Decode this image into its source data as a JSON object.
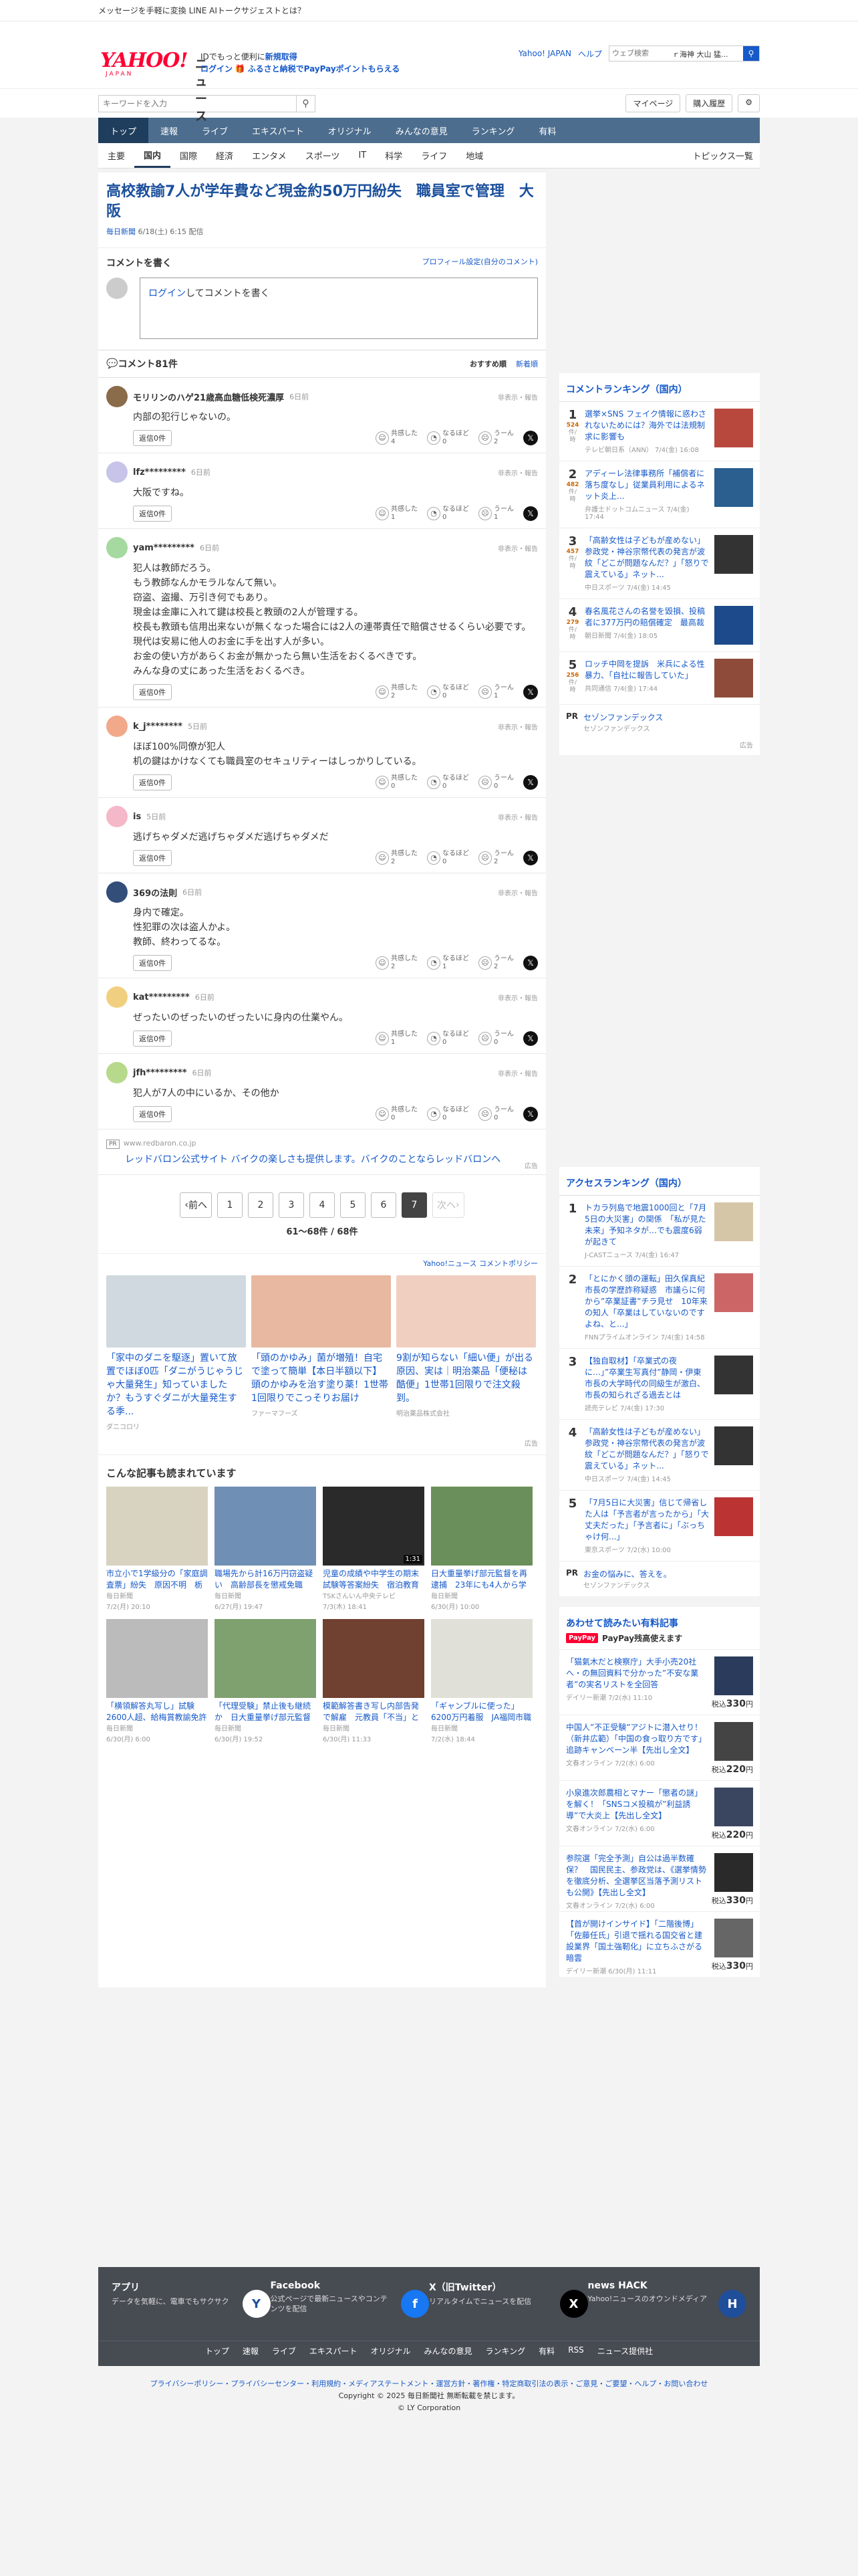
{
  "topstrip": {
    "text": "メッセージを手軽に変換 LINE AIトークサジェストとは？"
  },
  "header": {
    "logo_main": "YAHOO!",
    "logo_sub": "JAPAN",
    "logo_news": "ニュース",
    "promo_line1a": "IDでもっと便利に",
    "promo_line1b": "新規取得",
    "promo_line2a": "ログイン",
    "promo_line2b": "ふるさと納税でPayPayポイントもらえる",
    "links": [
      "Yahoo! JAPAN",
      "ヘルプ"
    ],
    "search_placeholder": "ウェブ検索",
    "search_value": "ｒ海神 大山 猛..."
  },
  "bar2": {
    "keyword_placeholder": "キーワードを入力",
    "mypage": "マイページ",
    "purchase": "購入履歴"
  },
  "gnav": [
    "トップ",
    "速報",
    "ライブ",
    "エキスパート",
    "オリジナル",
    "みんなの意見",
    "ランキング",
    "有料"
  ],
  "snav": [
    "主要",
    "国内",
    "国際",
    "経済",
    "エンタメ",
    "スポーツ",
    "IT",
    "科学",
    "ライフ",
    "地域"
  ],
  "snav_more": "トピックス一覧",
  "article": {
    "title": "高校教諭7人が学年費など現金約50万円紛失　職員室で管理　大阪",
    "publisher": "毎日新聞",
    "date": "6/18(土) 6:15 配信"
  },
  "comment_form": {
    "header": "コメントを書く",
    "profile_link": "プロフィール設定(自分のコメント)",
    "login": "ログイン",
    "rest": "してコメントを書く"
  },
  "comments_header": {
    "count": "コメント81件",
    "sort1": "おすすめ順",
    "sort2": "新着順"
  },
  "reply_label": "返信0件",
  "hide_label": "非表示・報告",
  "reaction_labels": [
    "共感した",
    "なるほど",
    "うーん"
  ],
  "comments": [
    {
      "user": "モリリンのハゲ21歳高血糖低検死濃厚",
      "time": "6日前",
      "text": "内部の犯行じゃないの。",
      "r": [
        "4",
        "0",
        "2"
      ],
      "color": "#8a6b4a"
    },
    {
      "user": "lfz*********",
      "time": "6日前",
      "text": "大阪ですね。",
      "r": [
        "1",
        "0",
        "1"
      ],
      "color": "#c7c4ea"
    },
    {
      "user": "yam*********",
      "time": "6日前",
      "text": "犯人は教師だろう。\nもう教師なんかモラルなんて無い。\n窃盗、盗撮、万引き何でもあり。\n現金は金庫に入れて鍵は校長と教頭の2人が管理する。\n校長も教頭も信用出来ないが無くなった場合には2人の連帯責任で賠償させるくらい必要です。\n現代は安易に他人のお金に手を出す人が多い。\nお金の使い方があらくお金が無かったら無い生活をおくるべきです。\nみんな身の丈にあった生活をおくるべき。",
      "r": [
        "2",
        "0",
        "1"
      ],
      "color": "#a6d9a0"
    },
    {
      "user": "k_j********",
      "time": "5日前",
      "text": "ほぼ100%同僚が犯人\n机の鍵はかけなくても職員室のセキュリティーはしっかりしている。",
      "r": [
        "0",
        "0",
        "0"
      ],
      "color": "#f1a98a"
    },
    {
      "user": "is",
      "time": "5日前",
      "text": "逃げちゃダメだ逃げちゃダメだ逃げちゃダメだ",
      "r": [
        "2",
        "0",
        "2"
      ],
      "color": "#f4b8c8"
    },
    {
      "user": "369の法則",
      "time": "6日前",
      "text": "身内で確定。\n性犯罪の次は盗人かよ。\n教師、終わってるな。",
      "r": [
        "2",
        "1",
        "2"
      ],
      "color": "#344e7a"
    },
    {
      "user": "kat*********",
      "time": "6日前",
      "text": "ぜったいのぜったいのぜったいに身内の仕業やん。",
      "r": [
        "1",
        "0",
        "0"
      ],
      "color": "#f0d080"
    },
    {
      "user": "jfh*********",
      "time": "6日前",
      "text": "犯人が7人の中にいるか、その他か",
      "r": [
        "0",
        "0",
        "0"
      ],
      "color": "#b7d98b"
    }
  ],
  "pr": {
    "tag": "PR",
    "url": "www.redbaron.co.jp",
    "text": "レッドバロン公式サイト バイクの楽しさも提供します。バイクのことならレッドバロンへ",
    "ad": "広告"
  },
  "pager": {
    "prev": "前へ",
    "next": "次へ",
    "pages": [
      "1",
      "2",
      "3",
      "4",
      "5",
      "6",
      "7"
    ],
    "current": "7",
    "info": "61〜68件 / 68件"
  },
  "policy": "Yahoo!ニュース コメントポリシー",
  "ads": [
    {
      "title": "「家中のダニを駆逐」置いて放置でほぼ0匹「ダニがうじゃうじゃ大量発生」知っていましたか？もうすぐダニが大量発生する季...",
      "sponsor": "ダニコロリ",
      "color": "#cfd9df"
    },
    {
      "title": "「頭のかゆみ」菌が増殖！自宅で塗って簡単【本日半額以下】頭のかゆみを治す塗り薬！1世帯1回限りでこっそりお届け",
      "sponsor": "ファーマフーズ",
      "color": "#e8b8a0"
    },
    {
      "title": "9割が知らない「細い便」が出る原因、実は｜明治薬品「便秘は酷便」1世帯1回限りで注文殺到。",
      "sponsor": "明治薬品株式会社",
      "color": "#f1cfc0"
    }
  ],
  "ad_label": "広告",
  "read_title": "こんな記事も読まれています",
  "read_items": [
    {
      "title": "市立小で1学級分の「家庭調査票」紛失　原因不明　栃木・小...",
      "src": "毎日新聞",
      "date": "7/2(月) 20:10",
      "color": "#d8d2c0",
      "dur": ""
    },
    {
      "title": "職場先から計16万円窃盗疑い　高齢部長を懲戒免職　神奈川県警",
      "src": "毎日新聞",
      "date": "6/27(月) 19:47",
      "color": "#6f8fb5",
      "dur": ""
    },
    {
      "title": "児童の成績や中学生の期末試験等答案紛失　宿泊教育関係の個人情報...",
      "src": "TSKさんいん中央テレビ",
      "date": "7/3(木) 18:41",
      "color": "#2a2a2a",
      "dur": "1:31"
    },
    {
      "title": "日大重量挙げ部元監督を再逮捕　23年にも4人から学費詐取疑い",
      "src": "毎日新聞",
      "date": "6/30(月) 10:00",
      "color": "#6a8f5a",
      "dur": ""
    },
    {
      "title": "「横領解答丸写し」試験　2600人超、給梅賞教諭免許を取得か",
      "src": "毎日新聞",
      "date": "6/30(月) 6:00",
      "color": "#bbbbbb",
      "dur": ""
    },
    {
      "title": "「代理受験」禁止後も継続か　日大重量挙げ部元監督の学費詐取...",
      "src": "毎日新聞",
      "date": "6/30(月) 19:52",
      "color": "#7fa06f",
      "dur": ""
    },
    {
      "title": "模範解答書き写し内部告発で解雇　元教員「不当」と仮処分申...",
      "src": "毎日新聞",
      "date": "6/30(月) 11:33",
      "color": "#704030",
      "dur": ""
    },
    {
      "title": "「ギャンブルに使った」6200万円着服　JA福岡市職員を懲戒解雇",
      "src": "毎日新聞",
      "date": "7/2(水) 18:44",
      "color": "#e0e0d8",
      "dur": ""
    }
  ],
  "comment_ranking": {
    "title": "コメントランキング（国内）",
    "items": [
      {
        "n": "1",
        "c": "524",
        "u": "件/時",
        "h": "選挙×SNS フェイク情報に惑わされないためには？海外では法規制求に影響も",
        "m": "テレビ朝日系（ANN） 7/4(金) 16:08",
        "color": "#b8483e"
      },
      {
        "n": "2",
        "c": "482",
        "u": "件/時",
        "h": "アディーレ法律事務所「補償者に落ち度なし」従業員利用によるネット炎上...",
        "m": "弁護士ドットコムニュース 7/4(金) 17:44",
        "color": "#2a5f8f"
      },
      {
        "n": "3",
        "c": "457",
        "u": "件/時",
        "h": "「高齢女性は子どもが産めない」参政党・神谷宗幣代表の発言が波紋「どこが問題なんだ？」「怒りで震えている」ネット...",
        "m": "中日スポーツ 7/4(金) 14:45",
        "color": "#333"
      },
      {
        "n": "4",
        "c": "279",
        "u": "件/時",
        "h": "春名風花さんの名誉を毀損、投稿者に377万円の賠償確定　最高裁",
        "m": "朝日新聞 7/4(金) 18:05",
        "color": "#1c4a8a"
      },
      {
        "n": "5",
        "c": "256",
        "u": "件/時",
        "h": "ロッチ中岡を提訴　米兵による性暴力、「自社に報告していた」",
        "m": "共同通信 7/4(金) 17:44",
        "color": "#8e4b3a"
      }
    ],
    "pr_title": "セゾンファンデックス",
    "pr_sub": "セゾンファンデックス"
  },
  "access_ranking": {
    "title": "アクセスランキング（国内）",
    "items": [
      {
        "n": "1",
        "h": "トカラ列島で地震1000回と「7月5日の大災害」の関係　「私が見た未来」予知ネタが…でも震度6弱が起きて",
        "m": "J-CASTニュース 7/4(金) 16:47",
        "color": "#d5c6a8"
      },
      {
        "n": "2",
        "h": "「とにかく頭の運転」田久保真紀市長の学歴詐称疑惑　市議らに何から”卒業証書”チラ見せ　10年来の知人「卒業はしていないのですよね、と...」",
        "m": "FNNプライムオンライン 7/4(金) 14:58",
        "color": "#c66"
      },
      {
        "n": "3",
        "h": "【独自取材】「卒業式の夜に…」”卒業生写真付”静岡・伊東市長の大学時代の同級生が激白、市長の知られざる過去とは",
        "m": "読売テレビ 7/4(金) 17:30",
        "color": "#333"
      },
      {
        "n": "4",
        "h": "「高齢女性は子どもが産めない」参政党・神谷宗幣代表の発言が波紋「どこが問題なんだ？」「怒りで震えている」ネット...",
        "m": "中日スポーツ 7/4(金) 14:45",
        "color": "#333"
      },
      {
        "n": "5",
        "h": "「7月5日に大災害」信じて帰省した人は「予言者が言ったから」「大丈夫だった」「予言者に」「ぶっちゃけ何...」",
        "m": "東京スポーツ 7/2(水) 10:00",
        "color": "#b33"
      }
    ],
    "pr_title": "お金の悩みに、答えを。",
    "pr_sub": "セゾンファンデックス"
  },
  "paid": {
    "title": "あわせて読みたい有料記事",
    "logo": "PayPay",
    "logo_note": "PayPay残高使えます",
    "price_unit": "税込",
    "items": [
      {
        "h": "「猫氣木だと検察庁」大手小売20社へ・の無回資料で分かった”不安な業者”の実名リストを全回答",
        "m": "デイリー新潮 7/2(水) 11:10",
        "p": "330",
        "color": "#2b3b5c"
      },
      {
        "h": "中国人”不正受験”アジトに潜入せり！（新井広範）「中国の食っ取り方です」追跡キャンペーン半【先出し全文】",
        "m": "文春オンライン 7/2(水) 6:00",
        "p": "220",
        "color": "#444"
      },
      {
        "h": "小泉進次郎農相とマナー「懲者の謎」を解く！「SNSコメ投稿が”利益誘導”で大炎上【先出し全文】",
        "m": "文春オンライン 7/2(水) 6:00",
        "p": "220",
        "color": "#3a4660"
      },
      {
        "h": "参院選「完全予測」自公は過半数確保？　国民民主、参政党は、《選挙情勢を徹底分析、全選挙区当落予測リストも公開》【先出し全文】",
        "m": "文春オンライン 7/2(水) 6:00",
        "p": "330",
        "color": "#2a2a2a"
      },
      {
        "h": "【首が開けインサイド】「二階後博」「佐藤任氏」引退で揺れる国交省と建設業界「国土強靭化」に立ちふさがる暗雲",
        "m": "デイリー新潮 6/30(月) 11:11",
        "p": "330",
        "color": "#666"
      }
    ]
  },
  "footer": {
    "blocks": [
      {
        "title": "アプリ",
        "desc": "データを気軽に、電車でもサクサク",
        "icon": "Y",
        "color": "#fff"
      },
      {
        "title": "Facebook",
        "desc": "公式ページで最新ニュースやコンテンツを配信",
        "icon": "f",
        "color": "#1877f2"
      },
      {
        "title": "X（旧Twitter）",
        "desc": "リアルタイムでニュースを配信",
        "icon": "X",
        "color": "#000"
      },
      {
        "title": "news HACK",
        "desc": "Yahoo!ニュースのオウンドメディア",
        "icon": "H",
        "color": "#1f4f9a"
      }
    ],
    "links": [
      "トップ",
      "速報",
      "ライブ",
      "エキスパート",
      "オリジナル",
      "みんなの意見",
      "ランキング",
      "有料",
      "RSS",
      "ニュース提供社"
    ],
    "legal": "プライバシーポリシー・プライバシーセンター・利用規約・メディアステートメント・運営方針・著作権・特定商取引法の表示・ご意見・ご要望・ヘルプ・お問い合わせ",
    "copyright": "Copyright © 2025 毎日新聞社 無断転載を禁じます。",
    "corp": "© LY Corporation"
  }
}
